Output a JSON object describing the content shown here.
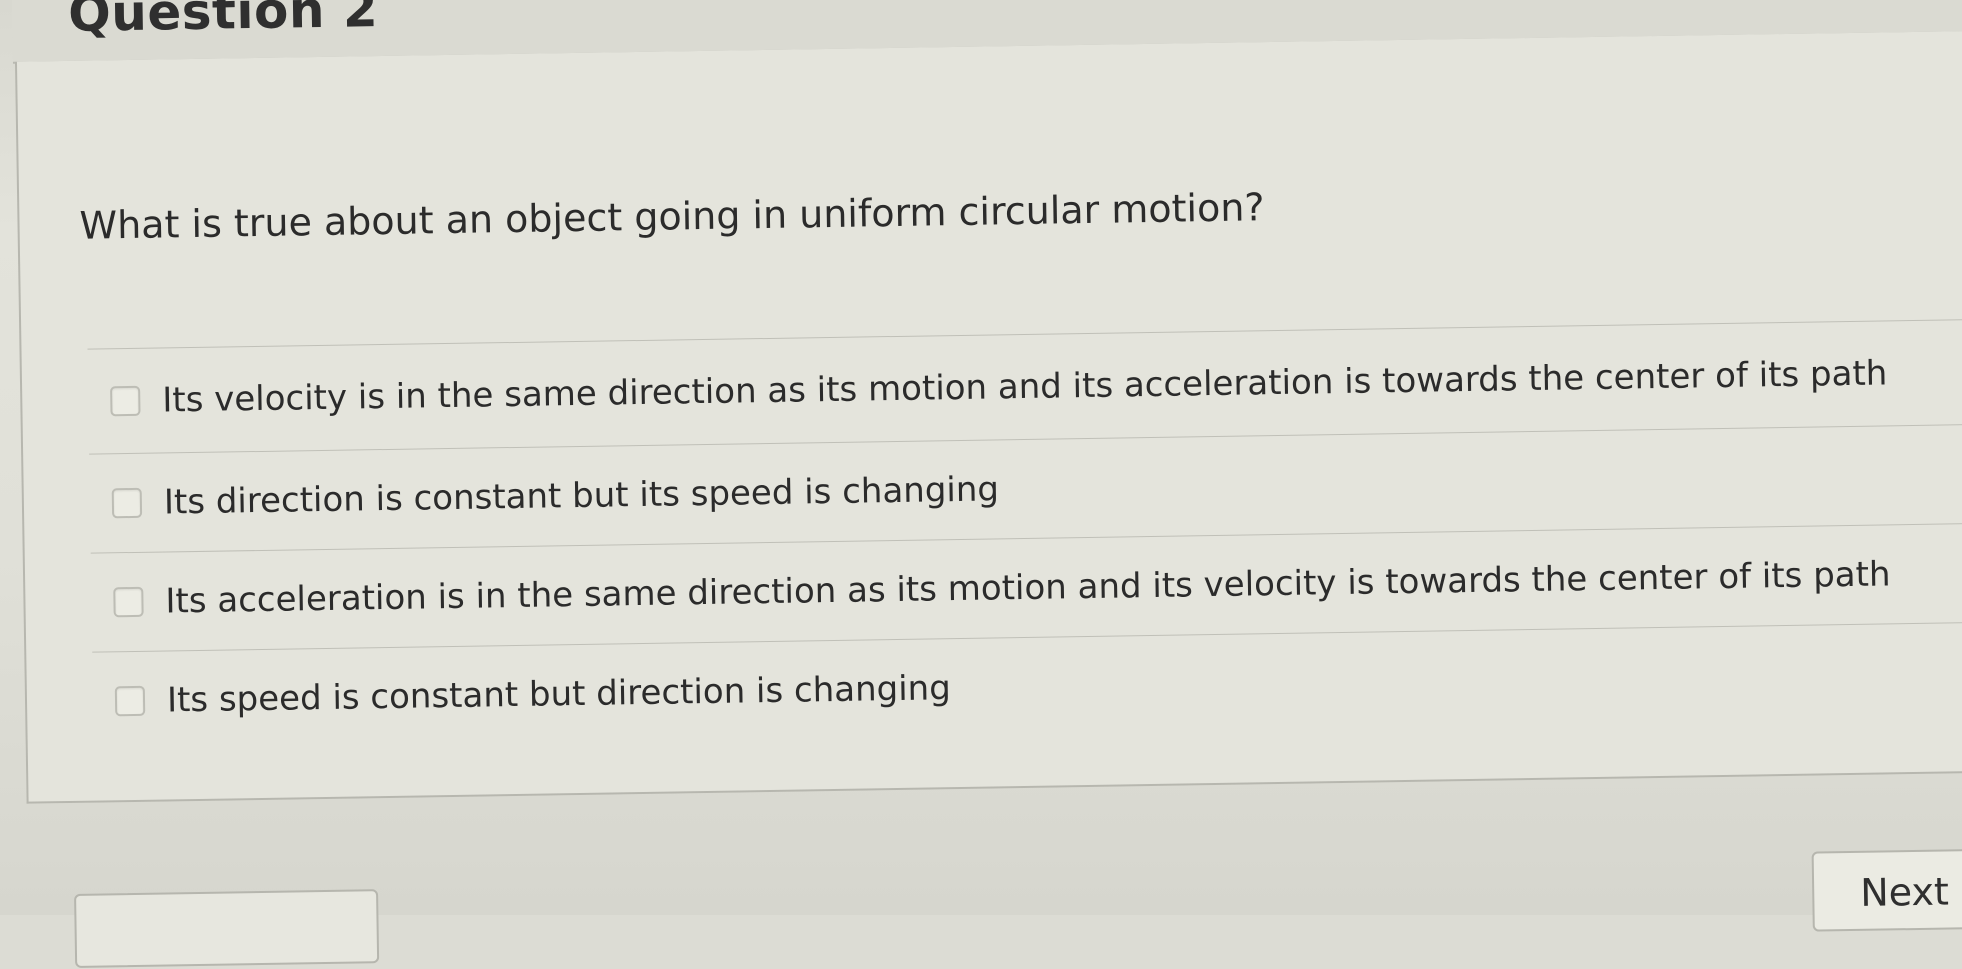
{
  "header": {
    "question_title": "Question 2"
  },
  "question": {
    "prompt": "What is true about an object going in uniform circular motion?"
  },
  "answers": [
    {
      "label": "Its velocity is in the same direction as its motion and its acceleration is towards the center of its path",
      "checked": false
    },
    {
      "label": "Its direction is constant but its speed is changing",
      "checked": false
    },
    {
      "label": "Its acceleration is in the same direction as its motion and its velocity is towards the center of its path",
      "checked": false
    },
    {
      "label": "Its speed is constant but direction is changing",
      "checked": false
    }
  ],
  "navigation": {
    "next_label": "Next"
  }
}
